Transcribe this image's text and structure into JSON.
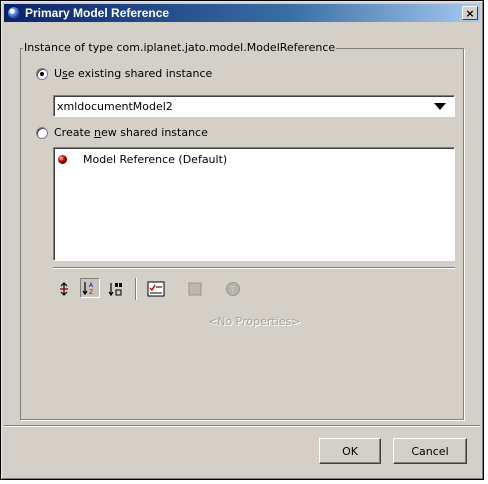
{
  "window": {
    "title": "Primary Model Reference",
    "close_label": "×"
  },
  "group": {
    "label": "Instance of type com.iplanet.jato.model.ModelReference"
  },
  "options": {
    "use_existing": {
      "label_prefix": "U",
      "label_mnemonic": "s",
      "label_rest": "e existing shared instance",
      "checked": true
    },
    "create_new": {
      "label_prefix": "Create ",
      "label_mnemonic": "n",
      "label_rest": "ew shared instance",
      "checked": false
    }
  },
  "combo": {
    "selected": "xmldocumentModel2"
  },
  "list": {
    "items": [
      {
        "label": "Model Reference (Default)",
        "icon": "model-bean-icon"
      }
    ]
  },
  "toolbar": {
    "icons": [
      "sort-none-icon",
      "sort-by-name-icon",
      "sort-by-type-icon",
      "property-list-icon",
      "disabled-square-icon",
      "help-icon"
    ]
  },
  "properties": {
    "empty_text": "<No Properties>"
  },
  "buttons": {
    "ok": "OK",
    "cancel": "Cancel"
  },
  "colors": {
    "titlebar_start": "#0a246a",
    "titlebar_end": "#a6caf0",
    "dialog_bg": "#d4d0c8",
    "disabled_text": "#a8a49c"
  }
}
